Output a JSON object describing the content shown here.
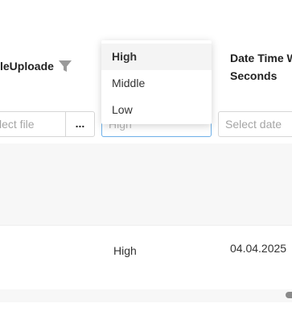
{
  "grid": {
    "columns": {
      "file_upload": {
        "header": "leUploade",
        "filter_placeholder": "lect file",
        "browse_label": "..."
      },
      "priority": {
        "filter_value": "High"
      },
      "date_time": {
        "header": "Date Time W Seconds",
        "filter_placeholder": "Select date"
      }
    },
    "rows": [
      {
        "priority": "High",
        "date_time": "04.04.2025"
      }
    ]
  },
  "dropdown": {
    "options": [
      {
        "label": "High",
        "selected": true
      },
      {
        "label": "Middle",
        "selected": false
      },
      {
        "label": "Low",
        "selected": false
      }
    ]
  },
  "colors": {
    "accent_border": "#6fb0e8",
    "filter_icon": "#9a9a9a"
  },
  "icons": {
    "filter": "filter-funnel-icon"
  }
}
